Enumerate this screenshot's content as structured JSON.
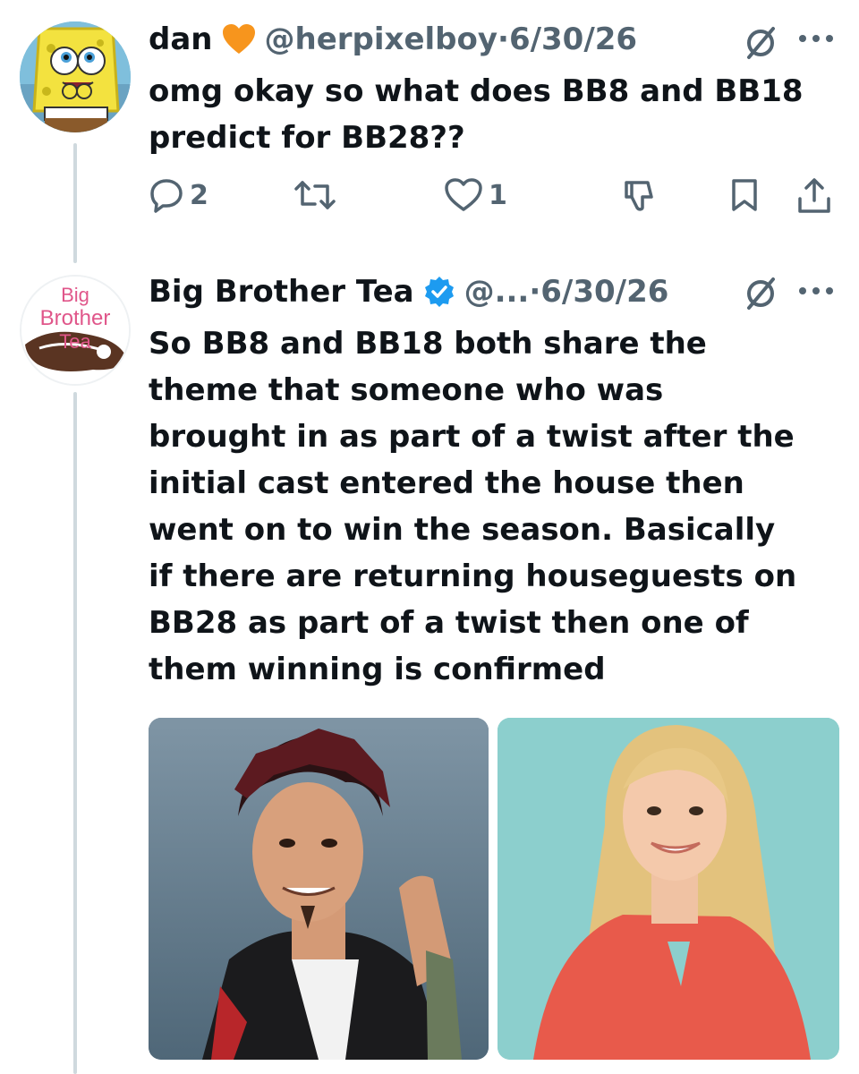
{
  "tweets": [
    {
      "display_name": "dan",
      "handle": "@herpixelboy",
      "separator": "·",
      "date": "6/30/26",
      "text_lines": [
        "omg okay so what does BB8 and BB18",
        "predict for BB28??"
      ],
      "reply_count": "2",
      "like_count": "1",
      "avatar_icon": "spongebob-avatar",
      "badge_icon": "orange-heart-icon"
    },
    {
      "display_name": "Big Brother Tea",
      "handle": "@...",
      "separator": "·",
      "date": "6/30/26",
      "text_lines": [
        "So BB8 and BB18 both share the",
        "theme that someone who was",
        "brought in as part of a twist after the",
        "initial cast entered the house then",
        "went on to win the season. Basically",
        "if there are returning houseguests on",
        "BB28 as part of a twist then one of",
        "them winning is confirmed"
      ],
      "avatar_words": [
        "Big",
        "Brother",
        "Tea"
      ],
      "badge_icon": "verified-badge-icon",
      "media": [
        "man-portrait-photo",
        "woman-portrait-photo"
      ]
    }
  ],
  "colors": {
    "text": "#0f1419",
    "meta": "#536471",
    "thread_line": "#cfd9de",
    "verified": "#1d9bf0",
    "heart_orange": "#f7951d",
    "avatar_text": "#e0568a"
  }
}
